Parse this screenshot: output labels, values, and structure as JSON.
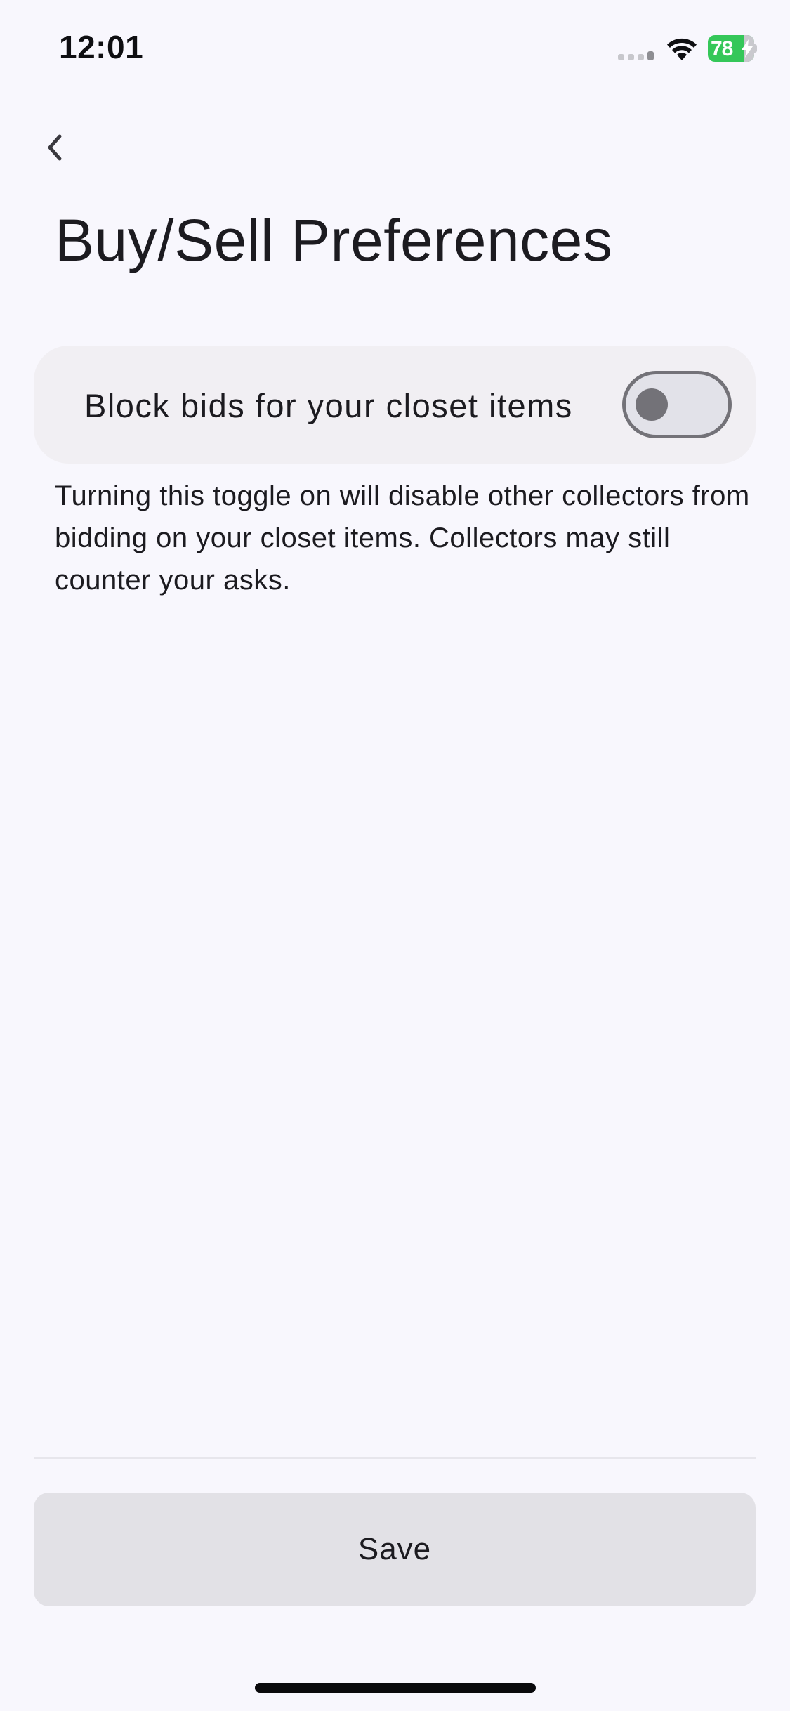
{
  "status_bar": {
    "time": "12:01",
    "battery_percent": "78",
    "battery_level": 0.78,
    "battery_charging": true,
    "battery_color": "#35c759",
    "signal_icon": "cellular-signal-icon",
    "wifi_icon": "wifi-icon"
  },
  "nav": {
    "back_icon": "chevron-left-icon"
  },
  "page": {
    "title": "Buy/Sell Preferences"
  },
  "settings": {
    "block_bids": {
      "label": "Block bids for your closet items",
      "enabled": false,
      "description": "Turning this toggle on will disable other collectors from bidding on your closet items. Collectors may still counter your asks."
    }
  },
  "footer": {
    "save_label": "Save"
  }
}
